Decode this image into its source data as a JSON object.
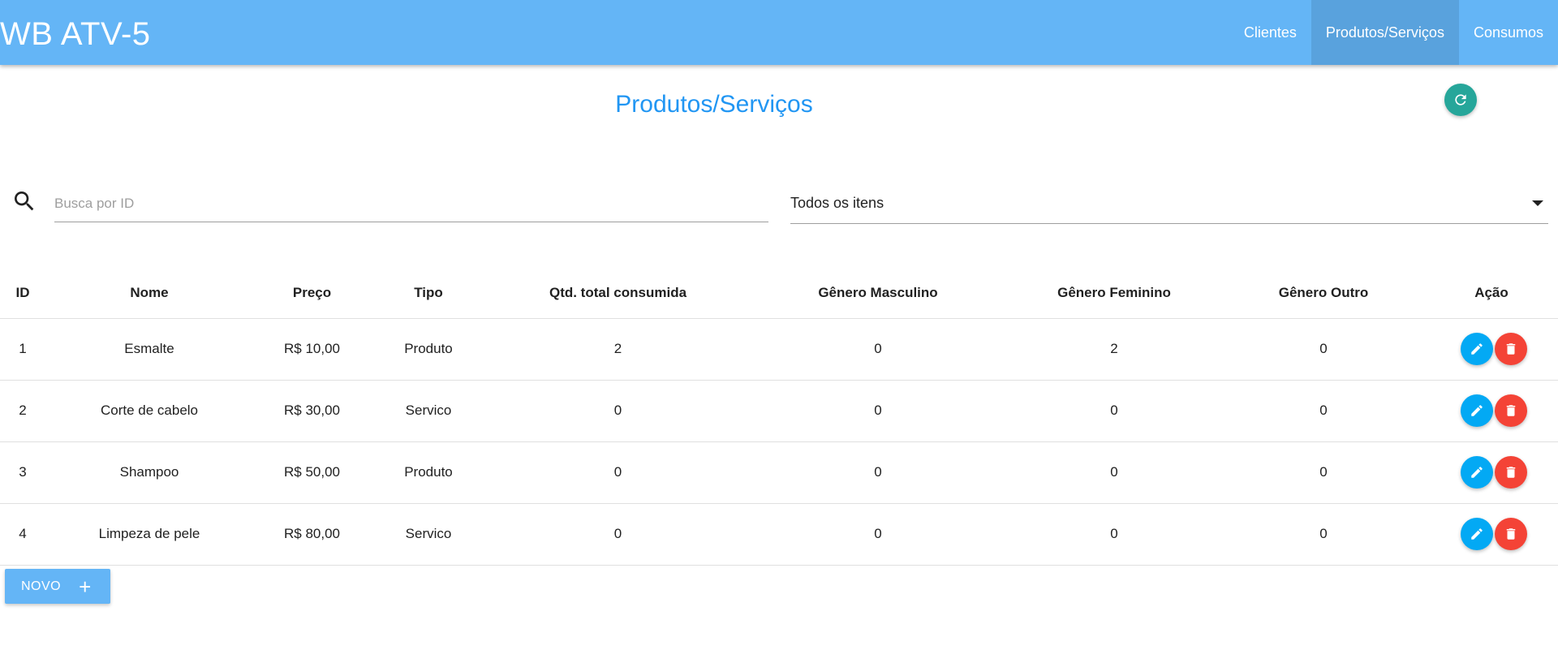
{
  "navbar": {
    "brand": "WB ATV-5",
    "links": [
      {
        "label": "Clientes",
        "active": false
      },
      {
        "label": "Produtos/Serviços",
        "active": true
      },
      {
        "label": "Consumos",
        "active": false
      }
    ]
  },
  "page": {
    "title": "Produtos/Serviços",
    "refresh_icon": "refresh-icon"
  },
  "filters": {
    "search_placeholder": "Busca por ID",
    "search_value": "",
    "select_value": "Todos os itens"
  },
  "table": {
    "headers": [
      "ID",
      "Nome",
      "Preço",
      "Tipo",
      "Qtd. total consumida",
      "Gênero Masculino",
      "Gênero Feminino",
      "Gênero Outro",
      "Ação"
    ],
    "rows": [
      {
        "id": "1",
        "nome": "Esmalte",
        "preco": "R$ 10,00",
        "tipo": "Produto",
        "qtd": "2",
        "masc": "0",
        "fem": "2",
        "outro": "0"
      },
      {
        "id": "2",
        "nome": "Corte de cabelo",
        "preco": "R$ 30,00",
        "tipo": "Servico",
        "qtd": "0",
        "masc": "0",
        "fem": "0",
        "outro": "0"
      },
      {
        "id": "3",
        "nome": "Shampoo",
        "preco": "R$ 50,00",
        "tipo": "Produto",
        "qtd": "0",
        "masc": "0",
        "fem": "0",
        "outro": "0"
      },
      {
        "id": "4",
        "nome": "Limpeza de pele",
        "preco": "R$ 80,00",
        "tipo": "Servico",
        "qtd": "0",
        "masc": "0",
        "fem": "0",
        "outro": "0"
      }
    ]
  },
  "new_button": {
    "label": "NOVO",
    "plus": "+"
  },
  "colors": {
    "navbar": "#64b5f6",
    "title": "#2196f3",
    "refresh": "#26a69a",
    "edit": "#03a9f4",
    "delete": "#f44336"
  }
}
